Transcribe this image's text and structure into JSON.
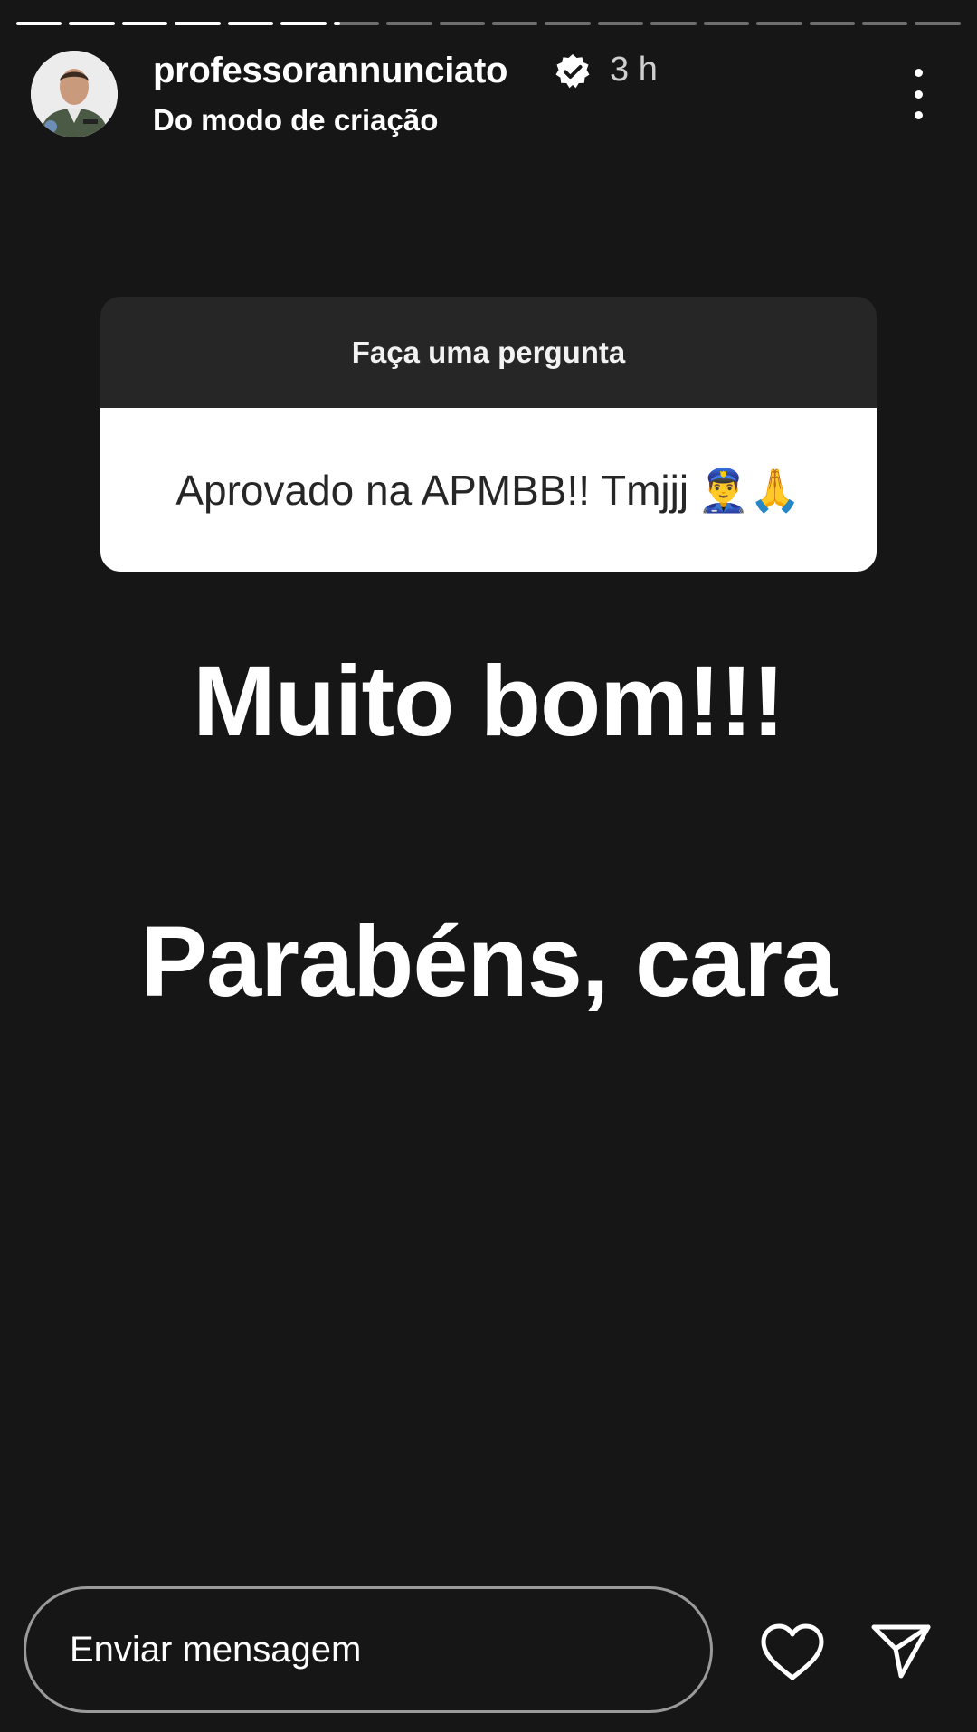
{
  "progress": {
    "segments_total": 18,
    "segments_complete": 6,
    "current_segment_fraction": 0.15
  },
  "header": {
    "username": "professorannunciato",
    "time": "3 h",
    "subtitle": "Do modo de criação"
  },
  "question_sticker": {
    "prompt": "Faça uma pergunta",
    "answer": "Aprovado na APMBB!! Tmjjj",
    "emojis": "👮‍♂️🙏"
  },
  "story_text": {
    "line1": "Muito bom!!!",
    "line2": "Parabéns, cara"
  },
  "footer": {
    "message_placeholder": "Enviar mensagem"
  },
  "icons": {
    "verified": "verified-badge-icon",
    "more": "more-options-icon",
    "like": "heart-icon",
    "share": "send-icon"
  },
  "colors": {
    "background": "#161616",
    "sticker_header": "#262626",
    "sticker_body": "#ffffff"
  }
}
